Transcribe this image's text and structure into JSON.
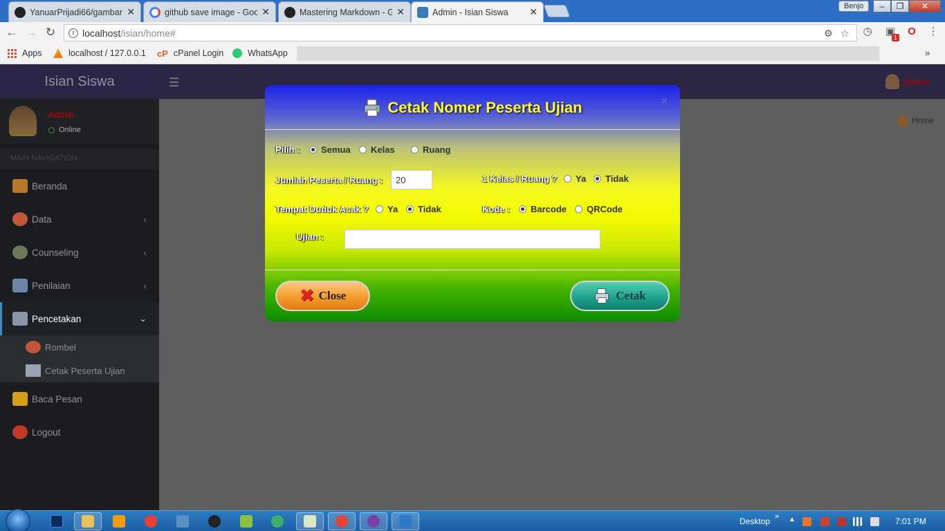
{
  "browser": {
    "tabs": [
      {
        "title": "YanuarPrijadi66/gambar",
        "icon": "github-icon"
      },
      {
        "title": "github save image - Goo",
        "icon": "google-icon"
      },
      {
        "title": "Mastering Markdown - G",
        "icon": "github-icon"
      },
      {
        "title": "Admin - Isian Siswa",
        "icon": "school-logo-icon"
      }
    ],
    "profile_name": "Benjo",
    "url_host": "localhost",
    "url_path": "/isian/home#",
    "extension_badge": "1",
    "bookmarks": [
      {
        "label": "Apps",
        "icon": "apps-grid-icon"
      },
      {
        "label": "localhost / 127.0.0.1",
        "icon": "phpmyadmin-icon"
      },
      {
        "label": "cPanel Login",
        "icon": "cpanel-icon"
      },
      {
        "label": "WhatsApp",
        "icon": "whatsapp-icon"
      }
    ]
  },
  "app": {
    "logo": "Isian Siswa",
    "header_user": "Admin",
    "user_panel": {
      "name": "Admin",
      "status": "Online"
    },
    "nav_header": "MAIN NAVIGATION",
    "nav": [
      {
        "label": "Beranda",
        "icon": "house-icon",
        "has_arrow": false
      },
      {
        "label": "Data",
        "icon": "people-icon",
        "has_arrow": true
      },
      {
        "label": "Counseling",
        "icon": "globe-icon",
        "has_arrow": true
      },
      {
        "label": "Penilaian",
        "icon": "certificate-icon",
        "has_arrow": true
      },
      {
        "label": "Pencetakan",
        "icon": "printer-icon",
        "has_arrow": true,
        "expanded": true
      },
      {
        "label": "Baca Pesan",
        "icon": "envelope-icon",
        "has_arrow": false
      },
      {
        "label": "Logout",
        "icon": "power-icon",
        "has_arrow": false
      }
    ],
    "submenu": [
      {
        "label": "Rombel",
        "icon": "group-icon"
      },
      {
        "label": "Cetak Peserta Ujian",
        "icon": "id-card-icon"
      }
    ],
    "breadcrumb": "Home"
  },
  "modal": {
    "title": "Cetak Nomer Peserta Ujian",
    "close_x": "×",
    "pilih_label": "Pilih :",
    "pilih_options": [
      {
        "label": "Semua",
        "checked": true
      },
      {
        "label": "Kelas",
        "checked": false
      },
      {
        "label": "Ruang",
        "checked": false
      }
    ],
    "jumlah_label": "Jumlah Peserta / Ruang :",
    "jumlah_value": "20",
    "kelas_ruang_label": "1 Kelas / Ruang ?",
    "kelas_ruang_options": [
      {
        "label": "Ya",
        "checked": false
      },
      {
        "label": "Tidak",
        "checked": true
      }
    ],
    "acak_label": "Tempat Duduk Acak ?",
    "acak_options": [
      {
        "label": "Ya",
        "checked": false
      },
      {
        "label": "Tidak",
        "checked": true
      }
    ],
    "kode_label": "Kode :",
    "kode_options": [
      {
        "label": "Barcode",
        "checked": true
      },
      {
        "label": "QRCode",
        "checked": false
      }
    ],
    "ujian_label": "Ujian :",
    "ujian_value": "",
    "close_button": "Close",
    "cetak_button": "Cetak"
  },
  "taskbar": {
    "desktop_label": "Desktop",
    "time": "7:01 PM"
  },
  "colors": {
    "modal_title": "#ffff33",
    "sidebar_bg": "#1b1c20",
    "header_bg": "#2b2742",
    "accent_blue": "#3c8dbc",
    "admin_red": "#c00000"
  }
}
